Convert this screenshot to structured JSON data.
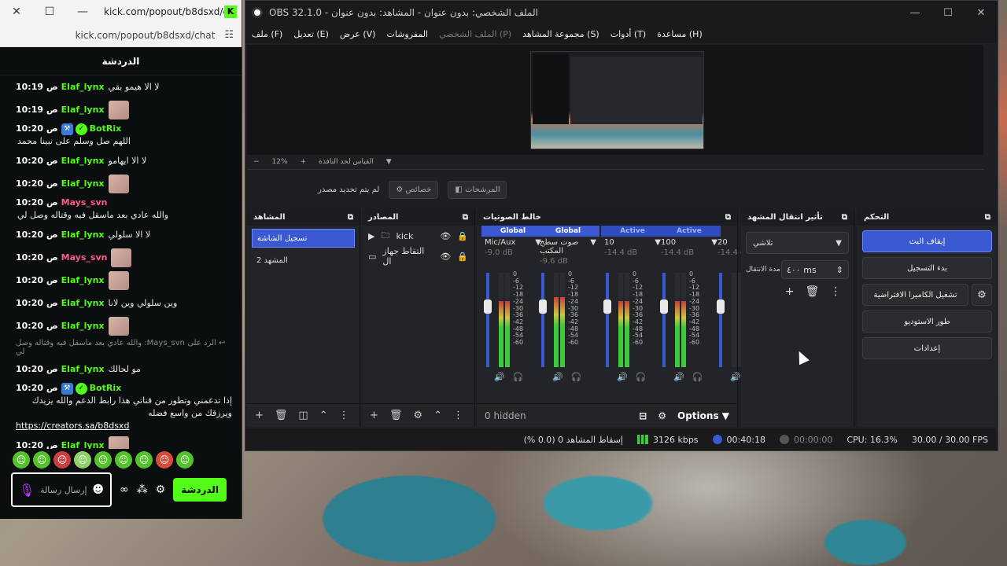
{
  "chat": {
    "window_title": "kick.com/popout/b8dsxd/c...",
    "url": "kick.com/popout/b8dsxd/chat",
    "header": "الدردشة",
    "messages": [
      {
        "time": "10:19 ص",
        "user": "Elaf_lynx",
        "user_color": "#53fc18",
        "text": "لا الا هيمو بقي",
        "emote": false,
        "bot": false
      },
      {
        "time": "10:19 ص",
        "user": "Elaf_lynx",
        "user_color": "#53fc18",
        "text": "",
        "emote": true,
        "bot": false
      },
      {
        "time": "10:20 ص",
        "user": "BotRix",
        "user_color": "#53fc18",
        "text": "اللهم صل وسلم على نبينا محمد",
        "emote": false,
        "bot": true
      },
      {
        "time": "10:20 ص",
        "user": "Elaf_lynx",
        "user_color": "#53fc18",
        "text": "لا الا ايهامو",
        "emote": false,
        "bot": false
      },
      {
        "time": "10:20 ص",
        "user": "Elaf_lynx",
        "user_color": "#53fc18",
        "text": "",
        "emote": true,
        "bot": false
      },
      {
        "time": "10:20 ص",
        "user": "Mays_svn",
        "user_color": "#ff5c8a",
        "text": "والله عادي بعد ماسقل فيه وقتاله وصل لي",
        "emote": false,
        "bot": false
      },
      {
        "time": "10:20 ص",
        "user": "Elaf_lynx",
        "user_color": "#53fc18",
        "text": "لا الا سلولي",
        "emote": false,
        "bot": false
      },
      {
        "time": "10:20 ص",
        "user": "Mays_svn",
        "user_color": "#ff5c8a",
        "text": "",
        "emote": true,
        "bot": false
      },
      {
        "time": "10:20 ص",
        "user": "Elaf_lynx",
        "user_color": "#53fc18",
        "text": "",
        "emote": true,
        "bot": false
      },
      {
        "time": "10:20 ص",
        "user": "Elaf_lynx",
        "user_color": "#53fc18",
        "text": "وين سلولي وين لانا",
        "emote": false,
        "bot": false
      },
      {
        "time": "10:20 ص",
        "user": "Elaf_lynx",
        "user_color": "#53fc18",
        "text": "",
        "emote": true,
        "bot": false
      }
    ],
    "reply": "الرد على Mays_svn: والله عادي بعد ماسقل فيه وقتاله وصل لي",
    "reply_message": {
      "time": "10:20 ص",
      "user": "Elaf_lynx",
      "text": "مو لحالك"
    },
    "bot_message": {
      "time": "10:20 ص",
      "user": "BotRix",
      "text": "إذا تدعمني وتطور من قناتي هذا رابط الدعم والله يزيدك ويرزقك من واسع فضله",
      "link": "https://creators.sa/b8dsxd"
    },
    "last_message": {
      "time": "10:20 ص",
      "user": "Elaf_lynx"
    },
    "send_label": "الدردشة",
    "input_placeholder": "إرسال رسالة"
  },
  "obs": {
    "title": "OBS 32.1.0 - الملف الشخصي: بدون عنوان - المشاهد: بدون عنوان",
    "menu": [
      "ملف (F)",
      "تعديل (E)",
      "عرض (V)",
      "المفروشات",
      "الملف الشخصي (P)",
      "مجموعة المشاهد (S)",
      "أدوات (T)",
      "مساعدة (H)"
    ],
    "zoom": "12%",
    "zoom_label": "القياس لحد النافذة",
    "no_source": "لم يتم تحديد مصدر",
    "properties": "خصائص",
    "filters": "المرشحات",
    "scenes": {
      "title": "المشاهد",
      "items": [
        "تسجيل الشاشة",
        "المشهد 2"
      ],
      "active": 0
    },
    "sources": {
      "title": "المصادر",
      "items": [
        {
          "name": "kick",
          "type": "folder"
        },
        {
          "name": "التقاط جهاز ال",
          "type": "display"
        }
      ]
    },
    "mixer": {
      "title": "خالط الصوتيات",
      "channels": [
        {
          "tag": "Global",
          "name": "Mic/Aux",
          "db": "-9.0 dB",
          "level": 0.7
        },
        {
          "tag": "Global",
          "name": "صوت سطح المكتب",
          "db": "-9.6 dB",
          "level": 0.74
        },
        {
          "tag": "Active",
          "name": "10",
          "db": "-14.4 dB",
          "level": 0.7
        },
        {
          "tag": "Active",
          "name": "100",
          "db": "-14.4 dB",
          "level": 0.7
        },
        {
          "tag": "",
          "name": "20",
          "db": "-14.4 dB",
          "level": 0.0
        }
      ],
      "scale": [
        "0",
        "-6",
        "-12",
        "-18",
        "-24",
        "-30",
        "-36",
        "-42",
        "-48",
        "-54",
        "-60"
      ],
      "hidden": "0 hidden",
      "options": "Options"
    },
    "transitions": {
      "title": "تأثير انتقال المشهد",
      "selected": "تلاشي",
      "duration_label": "مدة الانتقال",
      "duration": "٤٠٠ ms"
    },
    "controls": {
      "title": "التحكم",
      "stop_stream": "إيقاف البث",
      "start_record": "بدء التسجيل",
      "virtual_cam": "تشغيل الكاميرا الافتراضية",
      "studio_mode": "طور الاستوديو",
      "settings": "إعدادات"
    },
    "status": {
      "dropped": "إسقاط المشاهد 0 (0.0 %)",
      "bitrate": "3126 kbps",
      "stream_time": "00:40:18",
      "rec_time": "00:00:00",
      "cpu": "CPU: 16.3%",
      "fps": "30.00 / 30.00 FPS"
    }
  },
  "colors": {
    "accent": "#3c59d4",
    "kick_green": "#53fc18",
    "mays": "#ff5c8a"
  }
}
